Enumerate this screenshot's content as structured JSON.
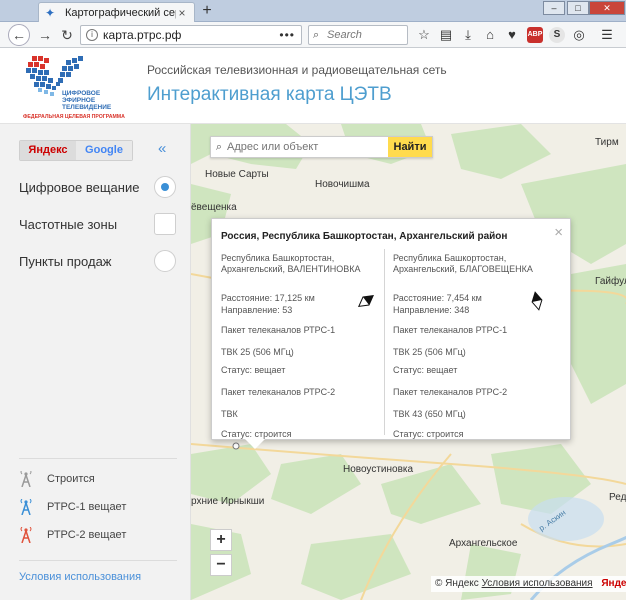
{
  "browser": {
    "tab_title": "Картографический сервис Р",
    "url": "карта.ртрс.рф",
    "search_placeholder": "Search",
    "colors": {
      "tabbar": "#bfcde0",
      "close": "#c9453a"
    }
  },
  "header": {
    "logo_text_line1": "ЦИФРОВОЕ",
    "logo_text_line2": "ЭФИРНОЕ",
    "logo_text_line3": "ТЕЛЕВИДЕНИЕ",
    "logo_text_line4": "ФЕДЕРАЛЬНАЯ ЦЕЛЕВАЯ ПРОГРАММА",
    "org": "Российская телевизионная и радиовещательная сеть",
    "title": "Интерактивная карта ЦЭТВ",
    "accent": "#4e9ecf"
  },
  "sidebar": {
    "providers": [
      "Яндекс",
      "Google"
    ],
    "collapse": "«",
    "layers": [
      {
        "label": "Цифровое вещание",
        "control": "radio",
        "selected": true
      },
      {
        "label": "Частотные зоны",
        "control": "checkbox",
        "selected": false
      },
      {
        "label": "Пункты продаж",
        "control": "radio",
        "selected": false
      }
    ],
    "legend": [
      {
        "label": "Строится",
        "icon": "antenna-gray-icon",
        "color": "#9a9a9a"
      },
      {
        "label": "РТРС-1 вещает",
        "icon": "antenna-blue-icon",
        "color": "#3a8fd6"
      },
      {
        "label": "РТРС-2 вещает",
        "icon": "antenna-red-icon",
        "color": "#e0533c"
      }
    ],
    "terms_link": "Условия использования"
  },
  "map": {
    "search_placeholder": "Адрес или объект",
    "search_button": "Найти",
    "zoom_in": "+",
    "zoom_out": "−",
    "labels": [
      "Новые Сарты",
      "Новочишма",
      "ёвещенка",
      "Тирм",
      "Гайфулл",
      "Новоустиновка",
      "рхние Ирныкши",
      "Архангельское",
      "Ред",
      "р. Аскин"
    ],
    "attribution_prefix": "© Яндекс",
    "attribution_link": "Условия использования",
    "attribution_brand": "Яндекс"
  },
  "balloon": {
    "title": "Россия, Республика Башкортостан, Архангельский район",
    "close": "×",
    "columns": [
      {
        "location": "Республика Башкортостан, Архангельский, ВАЛЕНТИНОВКА",
        "distance": "Расстояние: 17,125 км",
        "direction": "Направление: 53",
        "package1": "Пакет телеканалов РТРС-1",
        "channel1": "ТВК 25 (506 МГц)",
        "status1": "Статус: вещает",
        "package2": "Пакет телеканалов РТРС-2",
        "channel2": "ТВК",
        "status2": "Статус: строится"
      },
      {
        "location": "Республика Башкортостан, Архангельский, БЛАГОВЕЩЕНКА",
        "distance": "Расстояние: 7,454 км",
        "direction": "Направление: 348",
        "package1": "Пакет телеканалов РТРС-1",
        "channel1": "ТВК 25 (506 МГц)",
        "status1": "Статус: вещает",
        "package2": "Пакет телеканалов РТРС-2",
        "channel2": "ТВК 43 (650 МГц)",
        "status2": "Статус: строится"
      }
    ]
  }
}
